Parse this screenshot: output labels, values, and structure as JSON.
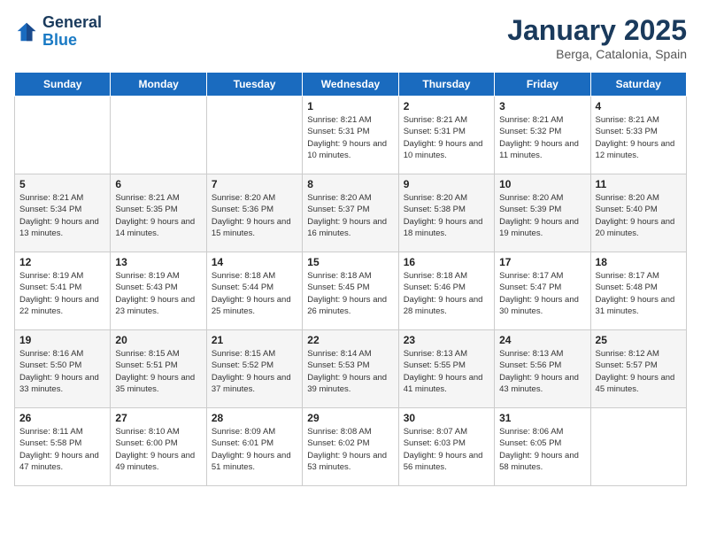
{
  "header": {
    "logo_line1": "General",
    "logo_line2": "Blue",
    "month": "January 2025",
    "location": "Berga, Catalonia, Spain"
  },
  "days_of_week": [
    "Sunday",
    "Monday",
    "Tuesday",
    "Wednesday",
    "Thursday",
    "Friday",
    "Saturday"
  ],
  "weeks": [
    [
      {
        "day": "",
        "content": ""
      },
      {
        "day": "",
        "content": ""
      },
      {
        "day": "",
        "content": ""
      },
      {
        "day": "1",
        "content": "Sunrise: 8:21 AM\nSunset: 5:31 PM\nDaylight: 9 hours\nand 10 minutes."
      },
      {
        "day": "2",
        "content": "Sunrise: 8:21 AM\nSunset: 5:31 PM\nDaylight: 9 hours\nand 10 minutes."
      },
      {
        "day": "3",
        "content": "Sunrise: 8:21 AM\nSunset: 5:32 PM\nDaylight: 9 hours\nand 11 minutes."
      },
      {
        "day": "4",
        "content": "Sunrise: 8:21 AM\nSunset: 5:33 PM\nDaylight: 9 hours\nand 12 minutes."
      }
    ],
    [
      {
        "day": "5",
        "content": "Sunrise: 8:21 AM\nSunset: 5:34 PM\nDaylight: 9 hours\nand 13 minutes."
      },
      {
        "day": "6",
        "content": "Sunrise: 8:21 AM\nSunset: 5:35 PM\nDaylight: 9 hours\nand 14 minutes."
      },
      {
        "day": "7",
        "content": "Sunrise: 8:20 AM\nSunset: 5:36 PM\nDaylight: 9 hours\nand 15 minutes."
      },
      {
        "day": "8",
        "content": "Sunrise: 8:20 AM\nSunset: 5:37 PM\nDaylight: 9 hours\nand 16 minutes."
      },
      {
        "day": "9",
        "content": "Sunrise: 8:20 AM\nSunset: 5:38 PM\nDaylight: 9 hours\nand 18 minutes."
      },
      {
        "day": "10",
        "content": "Sunrise: 8:20 AM\nSunset: 5:39 PM\nDaylight: 9 hours\nand 19 minutes."
      },
      {
        "day": "11",
        "content": "Sunrise: 8:20 AM\nSunset: 5:40 PM\nDaylight: 9 hours\nand 20 minutes."
      }
    ],
    [
      {
        "day": "12",
        "content": "Sunrise: 8:19 AM\nSunset: 5:41 PM\nDaylight: 9 hours\nand 22 minutes."
      },
      {
        "day": "13",
        "content": "Sunrise: 8:19 AM\nSunset: 5:43 PM\nDaylight: 9 hours\nand 23 minutes."
      },
      {
        "day": "14",
        "content": "Sunrise: 8:18 AM\nSunset: 5:44 PM\nDaylight: 9 hours\nand 25 minutes."
      },
      {
        "day": "15",
        "content": "Sunrise: 8:18 AM\nSunset: 5:45 PM\nDaylight: 9 hours\nand 26 minutes."
      },
      {
        "day": "16",
        "content": "Sunrise: 8:18 AM\nSunset: 5:46 PM\nDaylight: 9 hours\nand 28 minutes."
      },
      {
        "day": "17",
        "content": "Sunrise: 8:17 AM\nSunset: 5:47 PM\nDaylight: 9 hours\nand 30 minutes."
      },
      {
        "day": "18",
        "content": "Sunrise: 8:17 AM\nSunset: 5:48 PM\nDaylight: 9 hours\nand 31 minutes."
      }
    ],
    [
      {
        "day": "19",
        "content": "Sunrise: 8:16 AM\nSunset: 5:50 PM\nDaylight: 9 hours\nand 33 minutes."
      },
      {
        "day": "20",
        "content": "Sunrise: 8:15 AM\nSunset: 5:51 PM\nDaylight: 9 hours\nand 35 minutes."
      },
      {
        "day": "21",
        "content": "Sunrise: 8:15 AM\nSunset: 5:52 PM\nDaylight: 9 hours\nand 37 minutes."
      },
      {
        "day": "22",
        "content": "Sunrise: 8:14 AM\nSunset: 5:53 PM\nDaylight: 9 hours\nand 39 minutes."
      },
      {
        "day": "23",
        "content": "Sunrise: 8:13 AM\nSunset: 5:55 PM\nDaylight: 9 hours\nand 41 minutes."
      },
      {
        "day": "24",
        "content": "Sunrise: 8:13 AM\nSunset: 5:56 PM\nDaylight: 9 hours\nand 43 minutes."
      },
      {
        "day": "25",
        "content": "Sunrise: 8:12 AM\nSunset: 5:57 PM\nDaylight: 9 hours\nand 45 minutes."
      }
    ],
    [
      {
        "day": "26",
        "content": "Sunrise: 8:11 AM\nSunset: 5:58 PM\nDaylight: 9 hours\nand 47 minutes."
      },
      {
        "day": "27",
        "content": "Sunrise: 8:10 AM\nSunset: 6:00 PM\nDaylight: 9 hours\nand 49 minutes."
      },
      {
        "day": "28",
        "content": "Sunrise: 8:09 AM\nSunset: 6:01 PM\nDaylight: 9 hours\nand 51 minutes."
      },
      {
        "day": "29",
        "content": "Sunrise: 8:08 AM\nSunset: 6:02 PM\nDaylight: 9 hours\nand 53 minutes."
      },
      {
        "day": "30",
        "content": "Sunrise: 8:07 AM\nSunset: 6:03 PM\nDaylight: 9 hours\nand 56 minutes."
      },
      {
        "day": "31",
        "content": "Sunrise: 8:06 AM\nSunset: 6:05 PM\nDaylight: 9 hours\nand 58 minutes."
      },
      {
        "day": "",
        "content": ""
      }
    ]
  ]
}
